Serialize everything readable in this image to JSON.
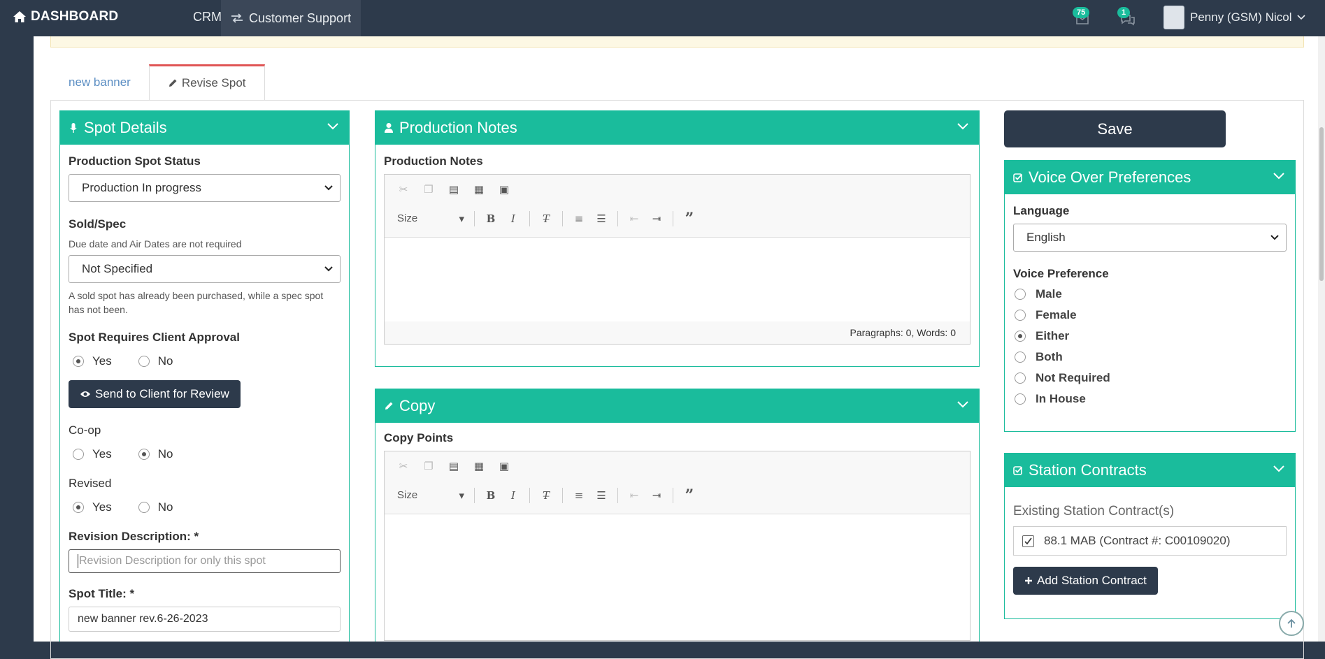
{
  "topbar": {
    "brand": "DASHBOARD",
    "nav_crm": "CRM",
    "nav_customer_support": "Customer Support",
    "mail_count": "75",
    "chat_count": "1",
    "user_name": "Penny (GSM) Nicol"
  },
  "tabs": [
    {
      "label": "new banner"
    },
    {
      "label": "Revise Spot"
    }
  ],
  "spot_details": {
    "title": "Spot Details",
    "status_label": "Production Spot Status",
    "status_value": "Production In progress",
    "sold_spec_label": "Sold/Spec",
    "sold_spec_help": "Due date and Air Dates are not required",
    "sold_spec_value": "Not Specified",
    "sold_spec_note": "A sold spot has already been purchased, while a spec spot has not been.",
    "approval_label": "Spot Requires Client Approval",
    "approval_yes": "Yes",
    "approval_no": "No",
    "send_review_label": "Send to Client for Review",
    "coop_label": "Co-op",
    "coop_yes": "Yes",
    "coop_no": "No",
    "revised_label": "Revised",
    "revised_yes": "Yes",
    "revised_no": "No",
    "revision_desc_label": "Revision Description: *",
    "revision_desc_placeholder": "Revision Description for only this spot",
    "spot_title_label": "Spot Title: *",
    "spot_title_value": "new banner rev.6-26-2023"
  },
  "production_notes": {
    "title": "Production Notes",
    "field_label": "Production Notes",
    "size_label": "Size",
    "footer": "Paragraphs: 0, Words: 0"
  },
  "copy": {
    "title": "Copy",
    "field_label": "Copy Points",
    "size_label": "Size"
  },
  "save_label": "Save",
  "voice_over": {
    "title": "Voice Over Preferences",
    "language_label": "Language",
    "language_value": "English",
    "pref_label": "Voice Preference",
    "options": [
      {
        "label": "Male",
        "selected": false
      },
      {
        "label": "Female",
        "selected": false
      },
      {
        "label": "Either",
        "selected": true
      },
      {
        "label": "Both",
        "selected": false
      },
      {
        "label": "Not Required",
        "selected": false
      },
      {
        "label": "In House",
        "selected": false
      }
    ]
  },
  "station_contracts": {
    "title": "Station Contracts",
    "existing_label": "Existing Station Contract(s)",
    "contract_item": "88.1 MAB (Contract #: C00109020)",
    "add_label": "Add Station Contract"
  },
  "colors": {
    "accent": "#1abc9c",
    "dark": "#2d3a4b",
    "tab_active_border": "#e05555"
  }
}
